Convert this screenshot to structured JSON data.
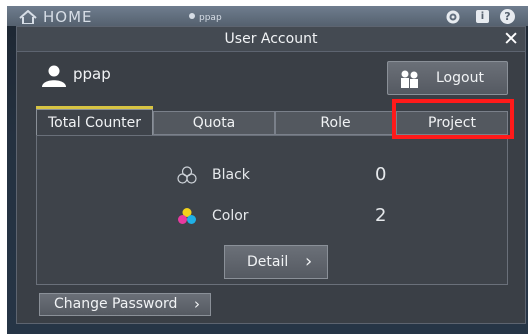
{
  "topbar": {
    "home_label": "HOME",
    "user_small": "ppap"
  },
  "dialog": {
    "title": "User Account",
    "close_glyph": "✕"
  },
  "user": {
    "name": "ppap"
  },
  "logout": {
    "label": "Logout"
  },
  "tabs": [
    {
      "label": "Total Counter",
      "active": true
    },
    {
      "label": "Quota",
      "active": false
    },
    {
      "label": "Role",
      "active": false
    },
    {
      "label": "Project",
      "active": false,
      "highlighted": true
    }
  ],
  "counters": [
    {
      "label": "Black",
      "value": "0",
      "icon": "black-toner-icon"
    },
    {
      "label": "Color",
      "value": "2",
      "icon": "color-toner-icon"
    }
  ],
  "detail": {
    "label": "Detail",
    "chevron": "›"
  },
  "change_password": {
    "label": "Change Password",
    "chevron": "›"
  },
  "colors": {
    "accent": "#d7c443",
    "highlight": "#ff1a1a",
    "panel": "#3e434a",
    "background": "#243140"
  }
}
